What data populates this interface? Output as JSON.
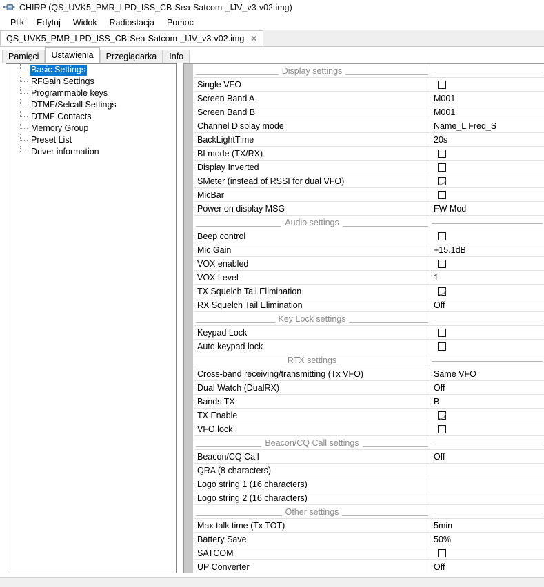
{
  "window": {
    "icon": "radio-icon",
    "title": "CHIRP (QS_UVK5_PMR_LPD_ISS_CB-Sea-Satcom-_IJV_v3-v02.img)"
  },
  "menubar": {
    "items": [
      {
        "label": "Plik"
      },
      {
        "label": "Edytuj"
      },
      {
        "label": "Widok"
      },
      {
        "label": "Radiostacja"
      },
      {
        "label": "Pomoc"
      }
    ]
  },
  "file_tabs": [
    {
      "label": "QS_UVK5_PMR_LPD_ISS_CB-Sea-Satcom-_IJV_v3-v02.img",
      "close_label": "✕",
      "active": true
    }
  ],
  "inner_tabs": [
    {
      "label": "Pamięci",
      "active": false
    },
    {
      "label": "Ustawienia",
      "active": true
    },
    {
      "label": "Przeglądarka",
      "active": false
    },
    {
      "label": "Info",
      "active": false
    }
  ],
  "sidebar": {
    "items": [
      {
        "label": "Basic Settings",
        "selected": true
      },
      {
        "label": "RFGain Settings",
        "selected": false
      },
      {
        "label": "Programmable keys",
        "selected": false
      },
      {
        "label": "DTMF/Selcall Settings",
        "selected": false
      },
      {
        "label": "DTMF Contacts",
        "selected": false
      },
      {
        "label": "Memory Group",
        "selected": false
      },
      {
        "label": "Preset List",
        "selected": false
      },
      {
        "label": "Driver information",
        "selected": false
      }
    ]
  },
  "colors": {
    "selection": "#0a7ad4",
    "section_text": "#8d8d8d",
    "gutter": "#c9c9c9",
    "row_border": "#e2e2e2"
  },
  "settings_rows": [
    {
      "type": "section",
      "name": "Display settings"
    },
    {
      "type": "checkbox",
      "name": "Single VFO",
      "checked": false
    },
    {
      "type": "value",
      "name": "Screen Band A",
      "value": "M001"
    },
    {
      "type": "value",
      "name": "Screen Band B",
      "value": "M001"
    },
    {
      "type": "value",
      "name": "Channel Display mode",
      "value": "Name_L Freq_S"
    },
    {
      "type": "value",
      "name": "BackLightTime",
      "value": "20s"
    },
    {
      "type": "checkbox",
      "name": "BLmode (TX/RX)",
      "checked": false
    },
    {
      "type": "checkbox",
      "name": "Display Inverted",
      "checked": false
    },
    {
      "type": "checkbox",
      "name": "SMeter (instead of RSSI for dual VFO)",
      "checked": true
    },
    {
      "type": "checkbox",
      "name": "MicBar",
      "checked": false
    },
    {
      "type": "value",
      "name": "Power on display MSG",
      "value": "FW Mod"
    },
    {
      "type": "section",
      "name": "Audio settings"
    },
    {
      "type": "checkbox",
      "name": "Beep control",
      "checked": false
    },
    {
      "type": "value",
      "name": "Mic Gain",
      "value": "+15.1dB"
    },
    {
      "type": "checkbox",
      "name": "VOX enabled",
      "checked": false
    },
    {
      "type": "value",
      "name": "VOX Level",
      "value": "1"
    },
    {
      "type": "checkbox",
      "name": "TX Squelch Tail Elimination",
      "checked": true
    },
    {
      "type": "value",
      "name": "RX Squelch Tail Elimination",
      "value": "Off"
    },
    {
      "type": "section",
      "name": "Key Lock settings"
    },
    {
      "type": "checkbox",
      "name": "Keypad Lock",
      "checked": false
    },
    {
      "type": "checkbox",
      "name": "Auto keypad lock",
      "checked": false
    },
    {
      "type": "section",
      "name": "RTX settings"
    },
    {
      "type": "value",
      "name": "Cross-band receiving/transmitting (Tx VFO)",
      "value": "Same VFO"
    },
    {
      "type": "value",
      "name": "Dual Watch (DualRX)",
      "value": "Off"
    },
    {
      "type": "value",
      "name": "Bands TX",
      "value": "B"
    },
    {
      "type": "checkbox",
      "name": "TX Enable",
      "checked": true
    },
    {
      "type": "checkbox",
      "name": "VFO lock",
      "checked": false
    },
    {
      "type": "section",
      "name": "Beacon/CQ Call settings"
    },
    {
      "type": "value",
      "name": "Beacon/CQ Call",
      "value": "Off"
    },
    {
      "type": "value",
      "name": "QRA (8 characters)",
      "value": ""
    },
    {
      "type": "value",
      "name": "Logo string 1 (16 characters)",
      "value": ""
    },
    {
      "type": "value",
      "name": "Logo string 2 (16 characters)",
      "value": ""
    },
    {
      "type": "section",
      "name": "Other settings"
    },
    {
      "type": "value",
      "name": "Max talk time (Tx TOT)",
      "value": "5min"
    },
    {
      "type": "value",
      "name": "Battery Save",
      "value": "50%"
    },
    {
      "type": "checkbox",
      "name": "SATCOM",
      "checked": false
    },
    {
      "type": "value",
      "name": "UP Converter",
      "value": "Off"
    }
  ]
}
